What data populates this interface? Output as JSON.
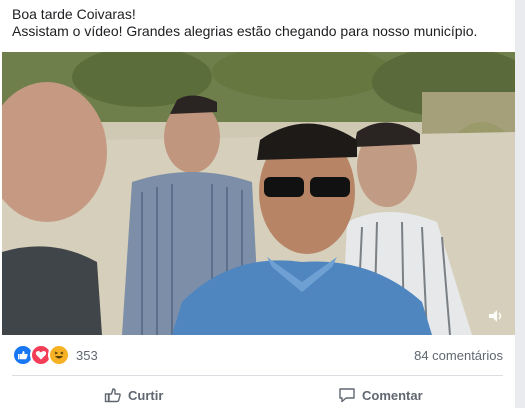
{
  "post": {
    "line1": "Boa tarde Coivaras!",
    "line2": "Assistam o vídeo! Grandes alegrias estão chegando para nosso município."
  },
  "video": {
    "description_icon": "video-frame",
    "sound_icon": "sound-icon"
  },
  "reactions": {
    "icons": [
      "like-icon",
      "love-icon",
      "haha-icon"
    ],
    "count": "353"
  },
  "comments": {
    "count_label": "84 comentários"
  },
  "actions": {
    "like_label": "Curtir",
    "comment_label": "Comentar"
  },
  "colors": {
    "like": "#1877f2",
    "love": "#f33e58",
    "haha": "#f7b125",
    "text": "#1c1e21",
    "muted": "#606770"
  }
}
